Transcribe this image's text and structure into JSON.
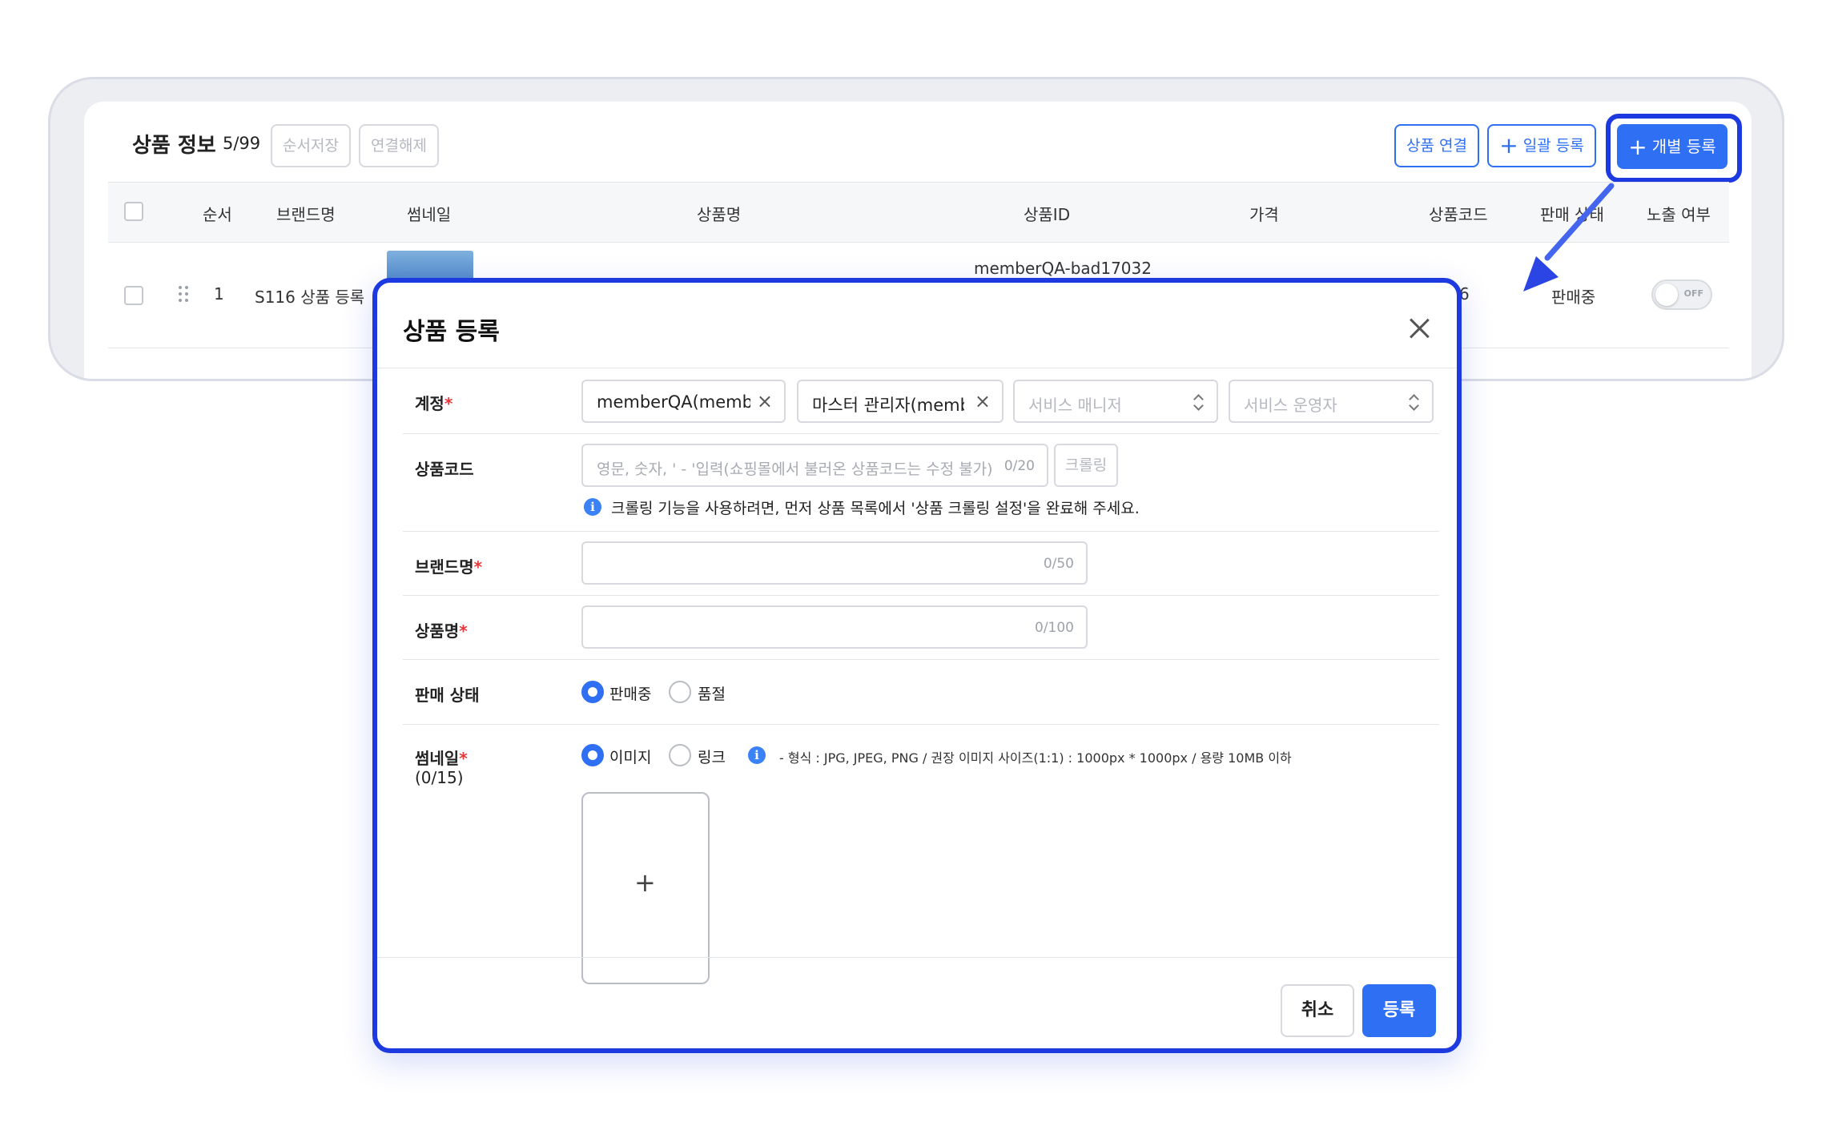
{
  "table_card": {
    "title": "상품 정보",
    "count": "5/99",
    "save_order_label": "순서저장",
    "unlink_label": "연결해제",
    "link_product_label": "상품 연결",
    "bulk_register_label": "일괄 등록",
    "single_register_label": "개별 등록",
    "plus_glyph": "+",
    "columns": [
      "순서",
      "브랜드명",
      "썸네일",
      "상품명",
      "상품ID",
      "가격",
      "상품코드",
      "판매 상태",
      "노출 여부"
    ],
    "row": {
      "order": "1",
      "brand": "S116 상품 등록",
      "product_id": "memberQA-bad17032",
      "product_code_partial": "6",
      "sale_status": "판매중",
      "toggle_label": "OFF"
    }
  },
  "modal": {
    "title": "상품 등록",
    "account": {
      "label": "계정",
      "required_mark": "*",
      "tag1": "memberQA(memberQA)",
      "tag2": "마스터 관리자(memberQA)",
      "remove_glyph": "×",
      "select_service_manager_placeholder": "서비스 매니저",
      "select_service_operator_placeholder": "서비스 운영자"
    },
    "product_code": {
      "label": "상품코드",
      "placeholder": "영문, 숫자, ' - '입력(쇼핑몰에서 불러온 상품코드는 수정 불가)",
      "counter": "0/20",
      "crawl_button": "크롤링",
      "hint": "크롤링 기능을 사용하려면, 먼저 상품 목록에서 '상품 크롤링 설정'을 완료해 주세요."
    },
    "brand": {
      "label": "브랜드명",
      "required_mark": "*",
      "counter": "0/50"
    },
    "name": {
      "label": "상품명",
      "required_mark": "*",
      "counter": "0/100"
    },
    "sale_status": {
      "label": "판매 상태",
      "options": [
        "판매중",
        "품절"
      ],
      "selected": "판매중"
    },
    "thumbnail": {
      "label": "썸네일",
      "required_mark": "*",
      "count": "(0/15)",
      "options": [
        "이미지",
        "링크"
      ],
      "selected": "이미지",
      "info_glyph": "i",
      "format_hint": "- 형식 : JPG, JPEG, PNG / 권장 이미지 사이즈(1:1) : 1000px * 1000px / 용량 10MB 이하",
      "upload_glyph": "+"
    },
    "footer": {
      "cancel_label": "취소",
      "submit_label": "등록"
    }
  },
  "colors": {
    "accent": "#2e6ff3",
    "highlight": "#1d3ae0",
    "required": "#e5383b"
  }
}
